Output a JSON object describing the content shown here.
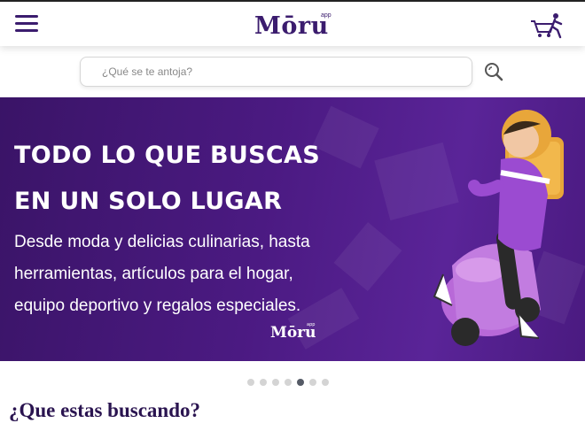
{
  "header": {
    "logo_text": "Mōru",
    "logo_sup": "app",
    "menu_icon": "hamburger-menu-icon",
    "cart_icon": "cart-delivery-icon"
  },
  "search": {
    "placeholder": "¿Qué se te antoja?",
    "value": "",
    "icon": "search-icon"
  },
  "banner": {
    "title": "TODO LO QUE BUSCAS EN UN SOLO LUGAR",
    "text": "Desde moda y delicias culinarias, hasta herramientas, artículos para el hogar, equipo deportivo y regalos especiales.",
    "logo_text": "Mōru",
    "logo_sup": "app"
  },
  "carousel": {
    "total": 7,
    "active_index": 4
  },
  "section": {
    "title": "¿Que estas buscando?"
  },
  "colors": {
    "brand": "#3b1c6e",
    "banner_bg": "#4b1a82",
    "dot_active": "#555a66",
    "dot_inactive": "#d4d4d4"
  }
}
